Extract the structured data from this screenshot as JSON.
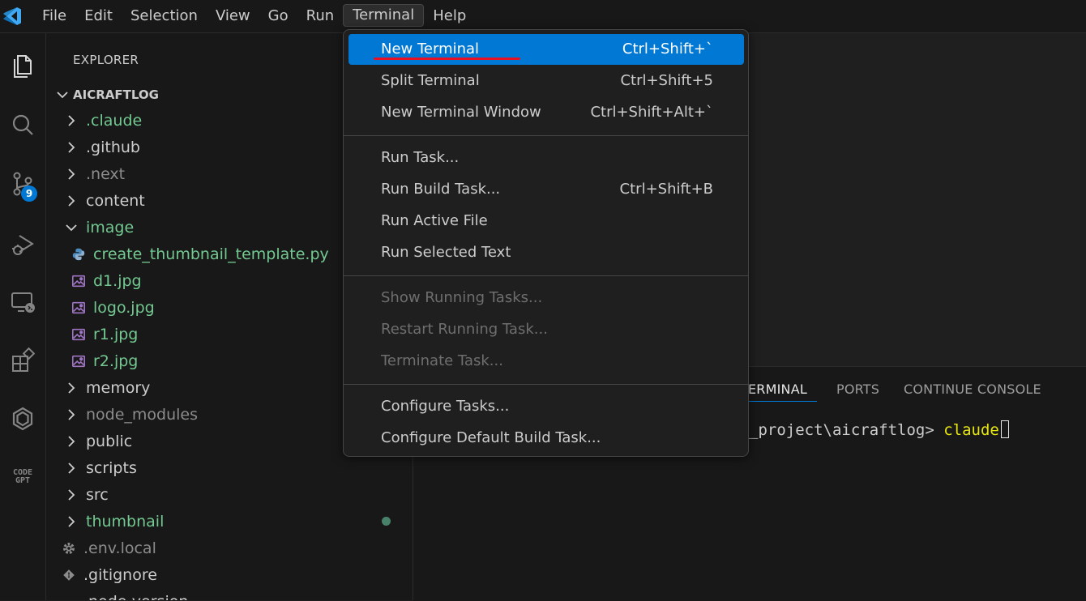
{
  "menubar": {
    "items": [
      "File",
      "Edit",
      "Selection",
      "View",
      "Go",
      "Run",
      "Terminal",
      "Help"
    ],
    "active": "Terminal"
  },
  "activitybar": {
    "icons": [
      "explorer-icon",
      "search-icon",
      "source-control-icon",
      "run-debug-icon",
      "remote-explorer-icon",
      "extensions-icon",
      "openai-icon",
      "codegpt-icon"
    ],
    "source_control_badge": "9"
  },
  "sidebar": {
    "title": "EXPLORER",
    "root": "AICRAFTLOG",
    "items": [
      {
        "label": ".claude",
        "type": "folder",
        "color": "#73c991"
      },
      {
        "label": ".github",
        "type": "folder",
        "color": "#cccccc"
      },
      {
        "label": ".next",
        "type": "folder",
        "color": "#8c8c8c"
      },
      {
        "label": "content",
        "type": "folder",
        "color": "#cccccc"
      },
      {
        "label": "image",
        "type": "folder-open",
        "color": "#73c991"
      },
      {
        "label": "create_thumbnail_template.py",
        "type": "python-file",
        "color": "#73c991"
      },
      {
        "label": "d1.jpg",
        "type": "image-file",
        "color": "#73c991"
      },
      {
        "label": "logo.jpg",
        "type": "image-file",
        "color": "#73c991"
      },
      {
        "label": "r1.jpg",
        "type": "image-file",
        "color": "#73c991"
      },
      {
        "label": "r2.jpg",
        "type": "image-file",
        "color": "#73c991"
      },
      {
        "label": "memory",
        "type": "folder",
        "color": "#cccccc"
      },
      {
        "label": "node_modules",
        "type": "folder",
        "color": "#8c8c8c"
      },
      {
        "label": "public",
        "type": "folder",
        "color": "#cccccc"
      },
      {
        "label": "scripts",
        "type": "folder",
        "color": "#cccccc"
      },
      {
        "label": "src",
        "type": "folder",
        "color": "#cccccc"
      },
      {
        "label": "thumbnail",
        "type": "folder",
        "color": "#73c991"
      },
      {
        "label": ".env.local",
        "type": "settings-file",
        "color": "#8c8c8c"
      },
      {
        "label": ".gitignore",
        "type": "git-file",
        "color": "#cccccc"
      },
      {
        "label": ".node-version",
        "type": "file",
        "color": "#cccccc"
      }
    ]
  },
  "panel": {
    "tabs": [
      "TERMINAL",
      "PORTS",
      "CONTINUE CONSOLE"
    ],
    "active_tab": "TERMINAL",
    "terminal_prompt": "_project\\aicraftlog> ",
    "terminal_command": "claude"
  },
  "terminal_menu": {
    "groups": [
      [
        {
          "label": "New Terminal",
          "shortcut": "Ctrl+Shift+`",
          "highlighted": true,
          "disabled": false
        },
        {
          "label": "Split Terminal",
          "shortcut": "Ctrl+Shift+5",
          "highlighted": false,
          "disabled": false
        },
        {
          "label": "New Terminal Window",
          "shortcut": "Ctrl+Shift+Alt+`",
          "highlighted": false,
          "disabled": false
        }
      ],
      [
        {
          "label": "Run Task...",
          "shortcut": "",
          "highlighted": false,
          "disabled": false
        },
        {
          "label": "Run Build Task...",
          "shortcut": "Ctrl+Shift+B",
          "highlighted": false,
          "disabled": false
        },
        {
          "label": "Run Active File",
          "shortcut": "",
          "highlighted": false,
          "disabled": false
        },
        {
          "label": "Run Selected Text",
          "shortcut": "",
          "highlighted": false,
          "disabled": false
        }
      ],
      [
        {
          "label": "Show Running Tasks...",
          "shortcut": "",
          "highlighted": false,
          "disabled": true
        },
        {
          "label": "Restart Running Task...",
          "shortcut": "",
          "highlighted": false,
          "disabled": true
        },
        {
          "label": "Terminate Task...",
          "shortcut": "",
          "highlighted": false,
          "disabled": true
        }
      ],
      [
        {
          "label": "Configure Tasks...",
          "shortcut": "",
          "highlighted": false,
          "disabled": false
        },
        {
          "label": "Configure Default Build Task...",
          "shortcut": "",
          "highlighted": false,
          "disabled": false
        }
      ]
    ]
  },
  "colors": {
    "accent": "#0078d4",
    "annotation_underline": "#e81123",
    "git_added": "#73c991",
    "terminal_command": "#e5e510"
  }
}
